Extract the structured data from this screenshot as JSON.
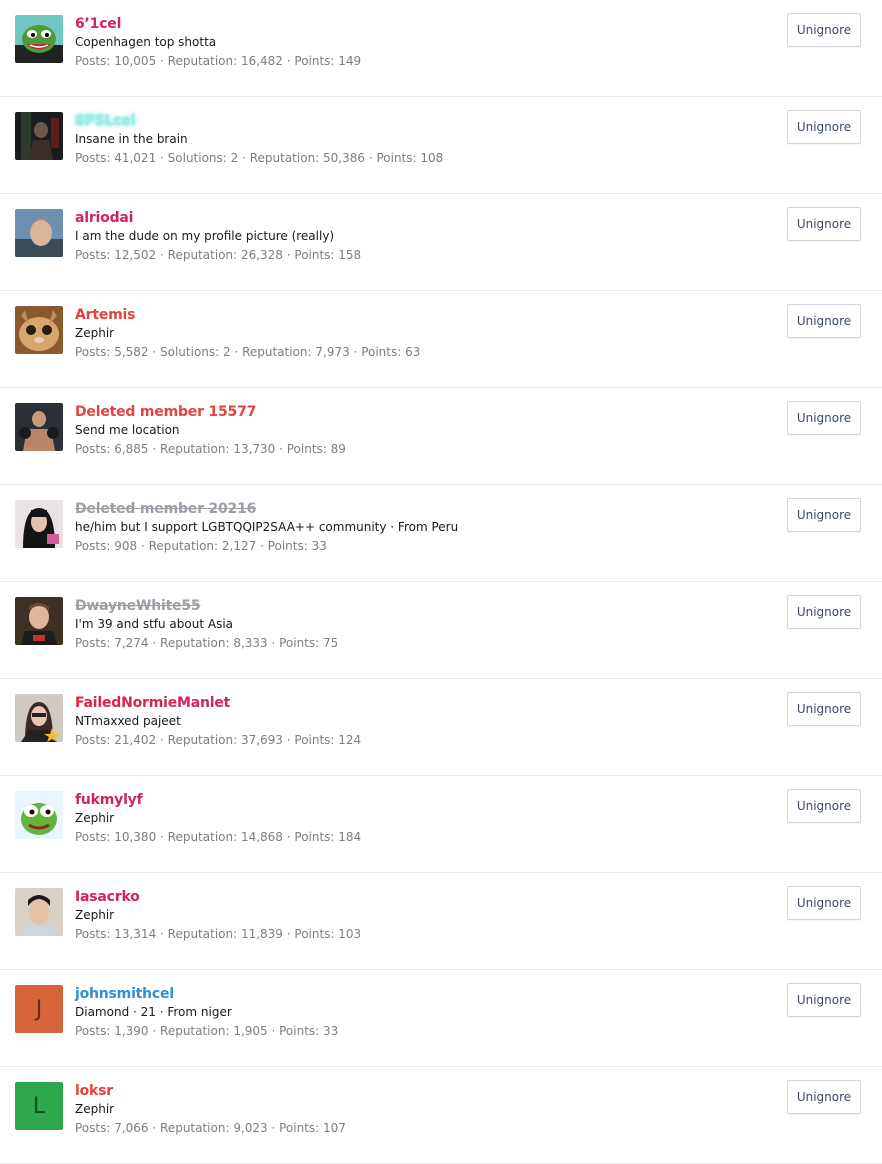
{
  "ignored_users": [
    {
      "username": "6’1cel",
      "name_color": "#d0245a",
      "deleted": false,
      "avatar": "pepe-smirk-avatar",
      "title": "Copenhagen top shotta",
      "stats": "Posts: 10,005 · Reputation: 16,482 · Points: 149",
      "button_label": "Unignore"
    },
    {
      "username": "8PSLcel",
      "name_color": "#a6ece5",
      "deleted": false,
      "avatar": "dark-figure-avatar",
      "title": "Insane in the brain",
      "stats": "Posts: 41,021 · Solutions: 2 · Reputation: 50,386 · Points: 108",
      "button_label": "Unignore"
    },
    {
      "username": "alriodai",
      "name_color": "#d0245a",
      "deleted": false,
      "avatar": "face-photo-avatar",
      "title": "I am the dude on my profile picture (really)",
      "stats": "Posts: 12,502 · Reputation: 26,328 · Points: 158",
      "button_label": "Unignore"
    },
    {
      "username": "Artemis",
      "name_color": "#e5433f",
      "deleted": false,
      "avatar": "cat-avatar",
      "title": "Zephir",
      "stats": "Posts: 5,582 · Solutions: 2 · Reputation: 7,973 · Points: 63",
      "button_label": "Unignore"
    },
    {
      "username": "Deleted member 15577",
      "name_color": "#e5433f",
      "deleted": false,
      "avatar": "fighter-avatar",
      "title": "Send me location",
      "stats": "Posts: 6,885 · Reputation: 13,730 · Points: 89",
      "button_label": "Unignore"
    },
    {
      "username": "Deleted member 20216",
      "name_color": "#9aa0a6",
      "deleted": true,
      "avatar": "woman-photo-avatar",
      "title": "he/him but I support LGBTQQIP2SAA++ community · From Peru",
      "stats": "Posts: 908 · Reputation: 2,127 · Points: 33",
      "button_label": "Unignore"
    },
    {
      "username": "DwayneWhite55",
      "name_color": "#9aa0a6",
      "deleted": true,
      "avatar": "man-photo-avatar",
      "title": "I'm 39 and stfu about Asia",
      "stats": "Posts: 7,274 · Reputation: 8,333 · Points: 75",
      "button_label": "Unignore"
    },
    {
      "username": "FailedNormieManlet",
      "name_color_start": "#e0233f",
      "name_color_end": "#8a2ad8",
      "name_color": "#b02a8c",
      "deleted": false,
      "avatar": "woman-star-avatar",
      "title": "NTmaxxed pajeet",
      "stats": "Posts: 21,402 · Reputation: 37,693 · Points: 124",
      "button_label": "Unignore"
    },
    {
      "username": "fukmylyf",
      "name_color": "#d0245a",
      "deleted": false,
      "avatar": "pepe-avatar",
      "title": "Zephir",
      "stats": "Posts: 10,380 · Reputation: 14,868 · Points: 184",
      "button_label": "Unignore"
    },
    {
      "username": "Iasacrko",
      "name_color": "#d0245a",
      "deleted": false,
      "avatar": "young-man-avatar",
      "title": "Zephir",
      "stats": "Posts: 13,314 · Reputation: 11,839 · Points: 103",
      "button_label": "Unignore"
    },
    {
      "username": "johnsmithcel",
      "name_color": "#2f8fd8",
      "deleted": false,
      "avatar": "letter-avatar",
      "avatar_letter": "J",
      "avatar_color": "#d7653a",
      "title": "Diamond · 21 · From niger",
      "stats": "Posts: 1,390 · Reputation: 1,905 · Points: 33",
      "button_label": "Unignore"
    },
    {
      "username": "loksr",
      "name_color": "#e5433f",
      "deleted": false,
      "avatar": "letter-avatar",
      "avatar_letter": "L",
      "avatar_color": "#2ea64c",
      "title": "Zephir",
      "stats": "Posts: 7,066 · Reputation: 9,023 · Points: 107",
      "button_label": "Unignore"
    }
  ]
}
